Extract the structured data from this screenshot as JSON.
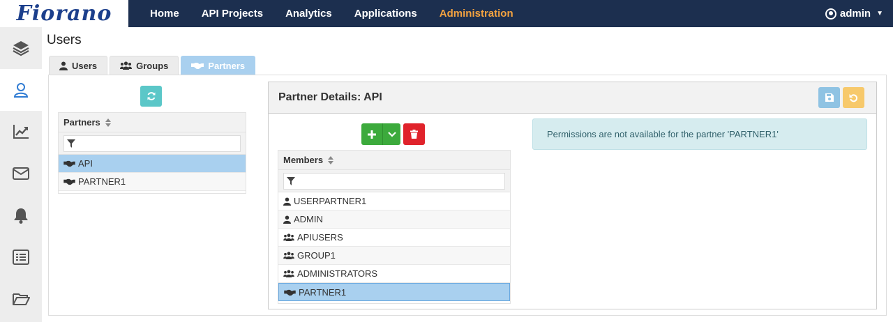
{
  "brand": {
    "logo_text": "Fiorano"
  },
  "nav": {
    "items": [
      {
        "label": "Home"
      },
      {
        "label": "API Projects"
      },
      {
        "label": "Analytics"
      },
      {
        "label": "Applications"
      },
      {
        "label": "Administration"
      }
    ],
    "active": "Administration"
  },
  "user_menu": {
    "label": "admin"
  },
  "sidebar": {
    "items": [
      {
        "icon": "layers-icon"
      },
      {
        "icon": "user-icon",
        "active": true
      },
      {
        "icon": "chart-icon"
      },
      {
        "icon": "mail-icon"
      },
      {
        "icon": "bell-icon"
      },
      {
        "icon": "list-icon"
      },
      {
        "icon": "folder-icon"
      }
    ]
  },
  "page": {
    "title": "Users"
  },
  "tabs": [
    {
      "label": "Users"
    },
    {
      "label": "Groups"
    },
    {
      "label": "Partners",
      "active": true
    }
  ],
  "partners_list": {
    "header": "Partners",
    "filter_value": "",
    "rows": [
      {
        "label": "API",
        "selected": true
      },
      {
        "label": "PARTNER1"
      }
    ]
  },
  "details": {
    "title": "Partner Details: API",
    "members": {
      "header": "Members",
      "filter_value": "",
      "rows": [
        {
          "label": "USERPARTNER1",
          "type": "user"
        },
        {
          "label": "ADMIN",
          "type": "user"
        },
        {
          "label": "APIUSERS",
          "type": "group"
        },
        {
          "label": "GROUP1",
          "type": "group"
        },
        {
          "label": "ADMINISTRATORS",
          "type": "group"
        },
        {
          "label": "PARTNER1",
          "type": "partner",
          "selected": true
        }
      ]
    },
    "permissions_message": "Permissions are not available for the partner 'PARTNER1'"
  },
  "colors": {
    "topbar": "#1c2f4f",
    "active_nav": "#f4a340",
    "selected_row": "#a9d0ef",
    "add_button": "#3caa3c",
    "delete_button": "#e0232b",
    "refresh_button": "#5bc7c8",
    "save_button": "#8fc3e3",
    "undo_button": "#f7c96b",
    "alert_bg": "#d6ecef"
  }
}
